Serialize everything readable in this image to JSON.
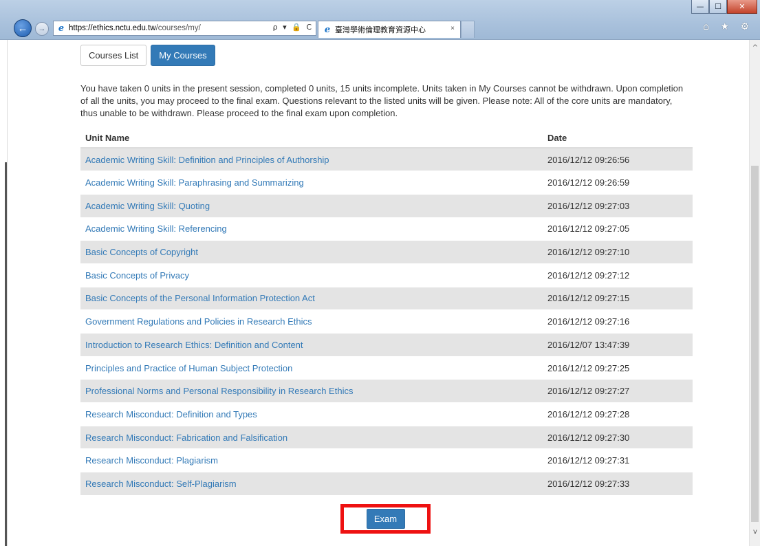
{
  "browser": {
    "url_host": "https://ethics.nctu.edu.tw",
    "url_path": "/courses/my/",
    "address_tools": "ρ ▾ 🔒 C",
    "tab_title": "臺灣學術倫理教育資源中心",
    "tab_close": "×",
    "window_minimize": "—",
    "window_maximize": "☐",
    "window_close": "✕",
    "right_icons": "⌂ ★ ⚙"
  },
  "tabs": {
    "courses_list": "Courses List",
    "my_courses": "My Courses"
  },
  "intro": "You have taken 0 units in the present session, completed 0 units, 15 units incomplete. Units taken in My Courses cannot be withdrawn. Upon completion of all the units, you may proceed to the final exam. Questions relevant to the listed units will be given. Please note: All of the core units are mandatory, thus unable to be withdrawn. Please proceed to the final exam upon completion.",
  "table": {
    "headers": {
      "unit_name": "Unit Name",
      "date": "Date"
    },
    "rows": [
      {
        "name": "Academic Writing Skill: Definition and Principles of Authorship",
        "date": "2016/12/12 09:26:56"
      },
      {
        "name": "Academic Writing Skill: Paraphrasing and Summarizing",
        "date": "2016/12/12 09:26:59"
      },
      {
        "name": "Academic Writing Skill: Quoting",
        "date": "2016/12/12 09:27:03"
      },
      {
        "name": "Academic Writing Skill: Referencing",
        "date": "2016/12/12 09:27:05"
      },
      {
        "name": "Basic Concepts of Copyright",
        "date": "2016/12/12 09:27:10"
      },
      {
        "name": "Basic Concepts of Privacy",
        "date": "2016/12/12 09:27:12"
      },
      {
        "name": "Basic Concepts of the Personal Information Protection Act",
        "date": "2016/12/12 09:27:15"
      },
      {
        "name": "Government Regulations and Policies in Research Ethics",
        "date": "2016/12/12 09:27:16"
      },
      {
        "name": "Introduction to Research Ethics: Definition and Content",
        "date": "2016/12/07 13:47:39"
      },
      {
        "name": "Principles and Practice of Human Subject Protection",
        "date": "2016/12/12 09:27:25"
      },
      {
        "name": "Professional Norms and Personal Responsibility in Research Ethics",
        "date": "2016/12/12 09:27:27"
      },
      {
        "name": "Research Misconduct: Definition and Types",
        "date": "2016/12/12 09:27:28"
      },
      {
        "name": "Research Misconduct: Fabrication and Falsification",
        "date": "2016/12/12 09:27:30"
      },
      {
        "name": "Research Misconduct: Plagiarism",
        "date": "2016/12/12 09:27:31"
      },
      {
        "name": "Research Misconduct: Self-Plagiarism",
        "date": "2016/12/12 09:27:33"
      }
    ]
  },
  "exam_button": "Exam",
  "colors": {
    "primary": "#337ab7",
    "highlight": "#ee1111",
    "row_stripe": "#e4e4e4"
  }
}
